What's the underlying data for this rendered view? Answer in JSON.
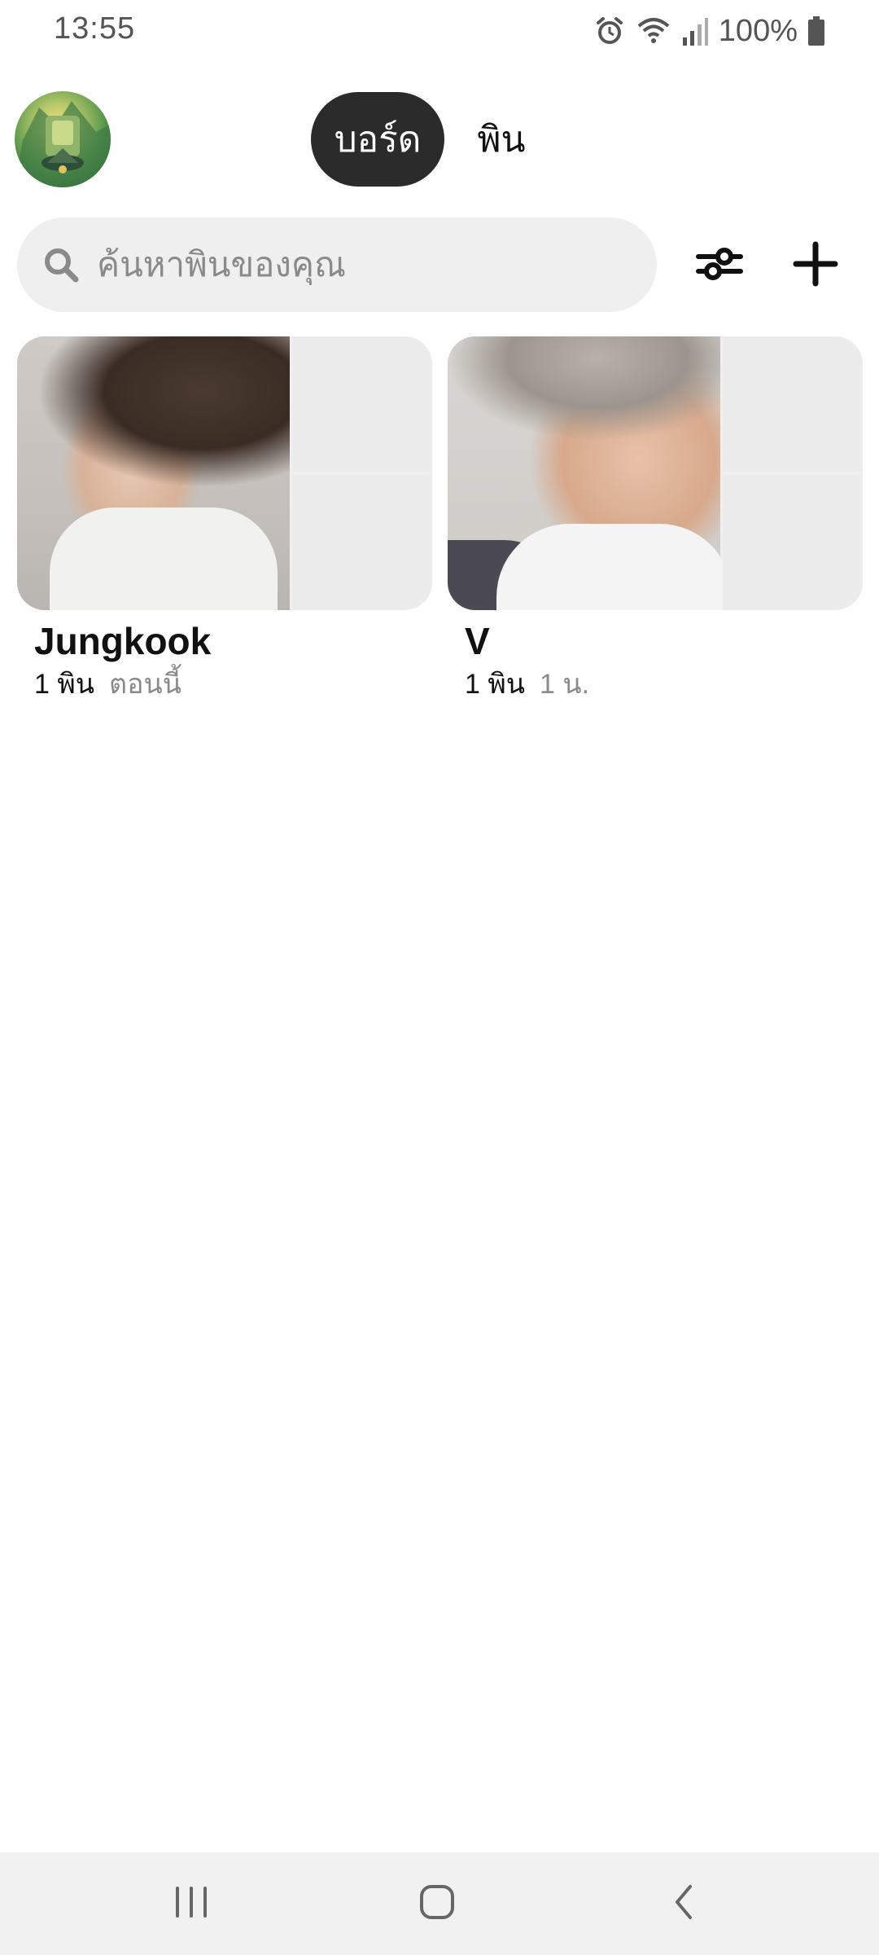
{
  "status_bar": {
    "time": "13:55",
    "battery_text": "100%",
    "icons": [
      "alarm-icon",
      "wifi-icon",
      "signal-icon",
      "battery-icon"
    ]
  },
  "header": {
    "tabs": [
      {
        "label": "บอร์ด",
        "active": true
      },
      {
        "label": "พิน",
        "active": false
      }
    ]
  },
  "search": {
    "placeholder": "ค้นหาพินของคุณ",
    "value": ""
  },
  "actions": {
    "filter_icon": "sliders-icon",
    "add_icon": "plus-icon"
  },
  "boards": [
    {
      "title": "Jungkook",
      "pin_count": "1 พิน",
      "time": "ตอนนี้"
    },
    {
      "title": "V",
      "pin_count": "1 พิน",
      "time": "1 น."
    }
  ],
  "nav": {
    "icons": [
      "recent-apps-icon",
      "home-icon",
      "back-icon"
    ]
  },
  "colors": {
    "active_tab_bg": "#2b2b2b",
    "search_bg": "#efefef",
    "muted_text": "#8a8a8a",
    "nav_bg": "#f1f1f1"
  }
}
